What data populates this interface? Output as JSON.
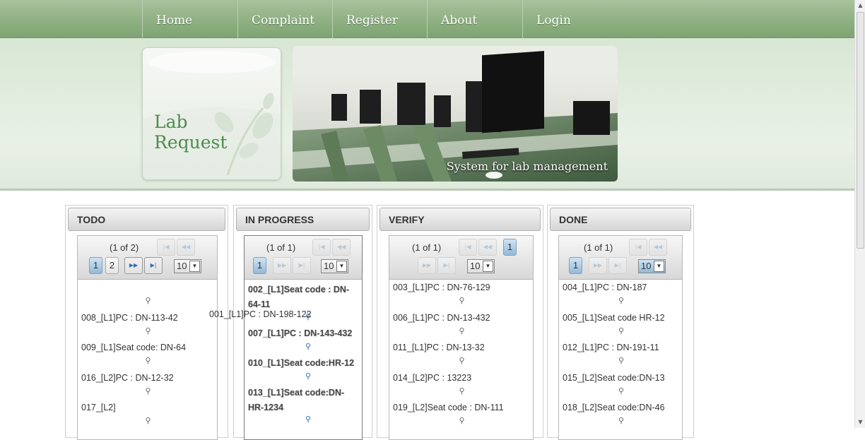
{
  "nav": {
    "items": [
      "Home",
      "Complaint",
      "Register",
      "About",
      "Login"
    ]
  },
  "header": {
    "logo_line1": "Lab",
    "logo_line2": "Request",
    "banner_caption": "System for lab management"
  },
  "columns": [
    {
      "title": "TODO",
      "page_count": "(1 of 2)",
      "pages": [
        "1",
        "2"
      ],
      "rows": "10",
      "items": [
        "008_[L1]PC : DN-113-42",
        "009_[L1]Seat code: DN-64",
        "016_[L2]PC : DN-12-32",
        "017_[L2]"
      ]
    },
    {
      "title": "IN PROGRESS",
      "page_count": "(1 of 1)",
      "pages": [
        "1"
      ],
      "rows": "10",
      "items": [
        "002_[L1]Seat code : DN-64-11",
        "007_[L1]PC : DN-143-432",
        "010_[L1]Seat code:HR-12",
        "013_[L1]Seat code:DN-HR-1234"
      ]
    },
    {
      "title": "VERIFY",
      "page_count": "(1 of 1)",
      "pages": [
        "1"
      ],
      "rows": "10",
      "items": [
        "003_[L1]PC : DN-76-129",
        "006_[L1]PC : DN-13-432",
        "011_[L1]PC : DN-13-32",
        "014_[L2]PC : 13223",
        "019_[L2]Seat code : DN-111"
      ]
    },
    {
      "title": "DONE",
      "page_count": "(1 of 1)",
      "pages": [
        "1"
      ],
      "rows": "10",
      "items": [
        "004_[L1]PC : DN-187",
        "005_[L1]Seat code HR-12",
        "012_[L1]PC : DN-191-11",
        "015_[L2]Seat code:DN-13",
        "018_[L2]Seat code:DN-46"
      ]
    }
  ],
  "dragged_item": "001_[L1]PC : DN-198-122",
  "icons": {
    "search": "magnifier-icon",
    "first": "first-page-icon",
    "prev": "prev-page-icon",
    "next": "next-page-icon",
    "last": "last-page-icon",
    "dropdown": "chevron-down-icon"
  },
  "colors": {
    "nav": "#8fb083",
    "logo_text": "#4f8a4d",
    "active_page": "#93b9d8"
  }
}
